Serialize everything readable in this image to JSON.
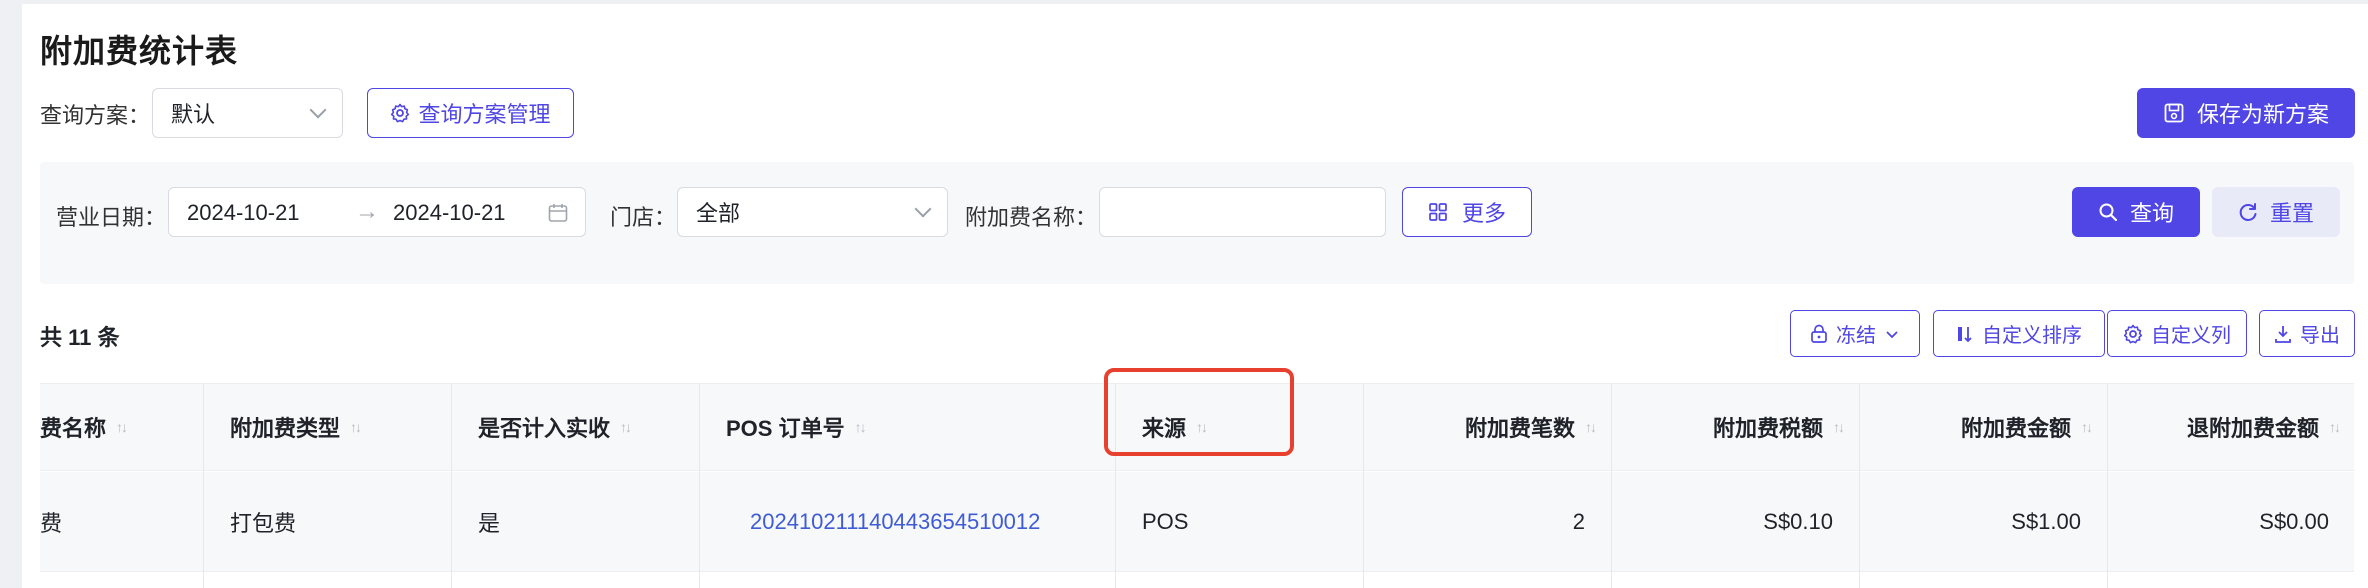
{
  "page": {
    "title": "附加费统计表"
  },
  "scheme": {
    "label": "查询方案：",
    "selected": "默认",
    "manage_label": "查询方案管理",
    "save_new_label": "保存为新方案"
  },
  "filters": {
    "date_label": "营业日期：",
    "date_start": "2024-10-21",
    "date_end": "2024-10-21",
    "date_separator": "→",
    "store_label": "门店：",
    "store_value": "全部",
    "surcharge_name_label": "附加费名称：",
    "surcharge_name_value": "",
    "more_label": "更多",
    "query_label": "查询",
    "reset_label": "重置"
  },
  "toolbar": {
    "count_text": "共 11 条",
    "freeze_label": "冻结",
    "custom_sort_label": "自定义排序",
    "custom_columns_label": "自定义列",
    "export_label": "导出"
  },
  "table": {
    "columns": [
      "费名称",
      "附加费类型",
      "是否计入实收",
      "POS 订单号",
      "来源",
      "附加费笔数",
      "附加费税额",
      "附加费金额",
      "退附加费金额"
    ],
    "rows": [
      [
        "费",
        "打包费",
        "是",
        "20241021114044365451001​2",
        "POS",
        "2",
        "S$0.10",
        "S$1.00",
        "S$0.00"
      ]
    ]
  },
  "colors": {
    "accent": "#4f46e5",
    "link": "#3f5bd6",
    "highlight": "#e8402f"
  }
}
